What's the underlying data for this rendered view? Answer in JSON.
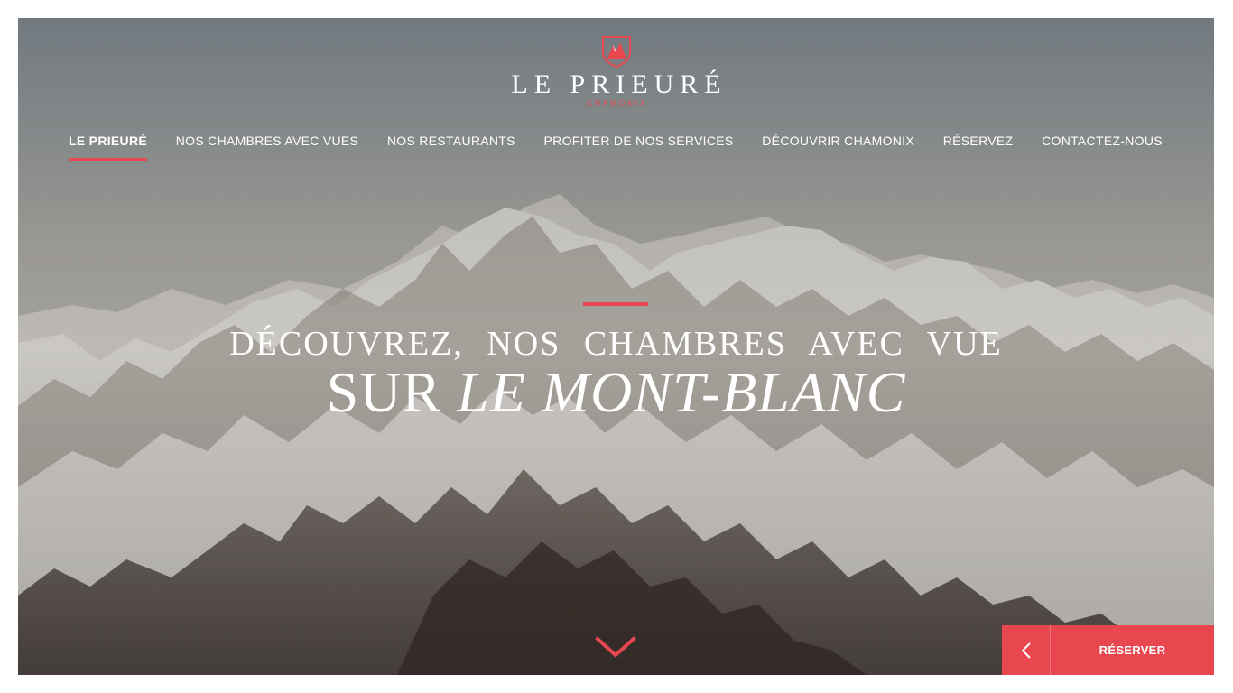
{
  "brand": {
    "name": "LE PRIEURÉ",
    "location": "CHAMONIX",
    "accent_color": "#e8474f"
  },
  "nav": {
    "items": [
      {
        "label": "LE PRIEURÉ",
        "active": true
      },
      {
        "label": "NOS CHAMBRES AVEC VUES",
        "active": false
      },
      {
        "label": "NOS RESTAURANTS",
        "active": false
      },
      {
        "label": "PROFITER DE NOS SERVICES",
        "active": false
      },
      {
        "label": "DÉCOUVRIR CHAMONIX",
        "active": false
      },
      {
        "label": "RÉSERVEZ",
        "active": false
      },
      {
        "label": "CONTACTEZ-NOUS",
        "active": false
      }
    ]
  },
  "hero": {
    "line1": "DÉCOUVREZ, NOS CHAMBRES AVEC VUE",
    "line2_prefix": "SUR",
    "line2_emphasis": "LE MONT-BLANC",
    "background": "snowy-mountain-range-photo"
  },
  "icons": {
    "logo": "mountain-shield-icon",
    "scroll": "chevron-down-icon",
    "prev": "chevron-left-icon"
  },
  "reserve": {
    "label": "RÉSERVER"
  }
}
